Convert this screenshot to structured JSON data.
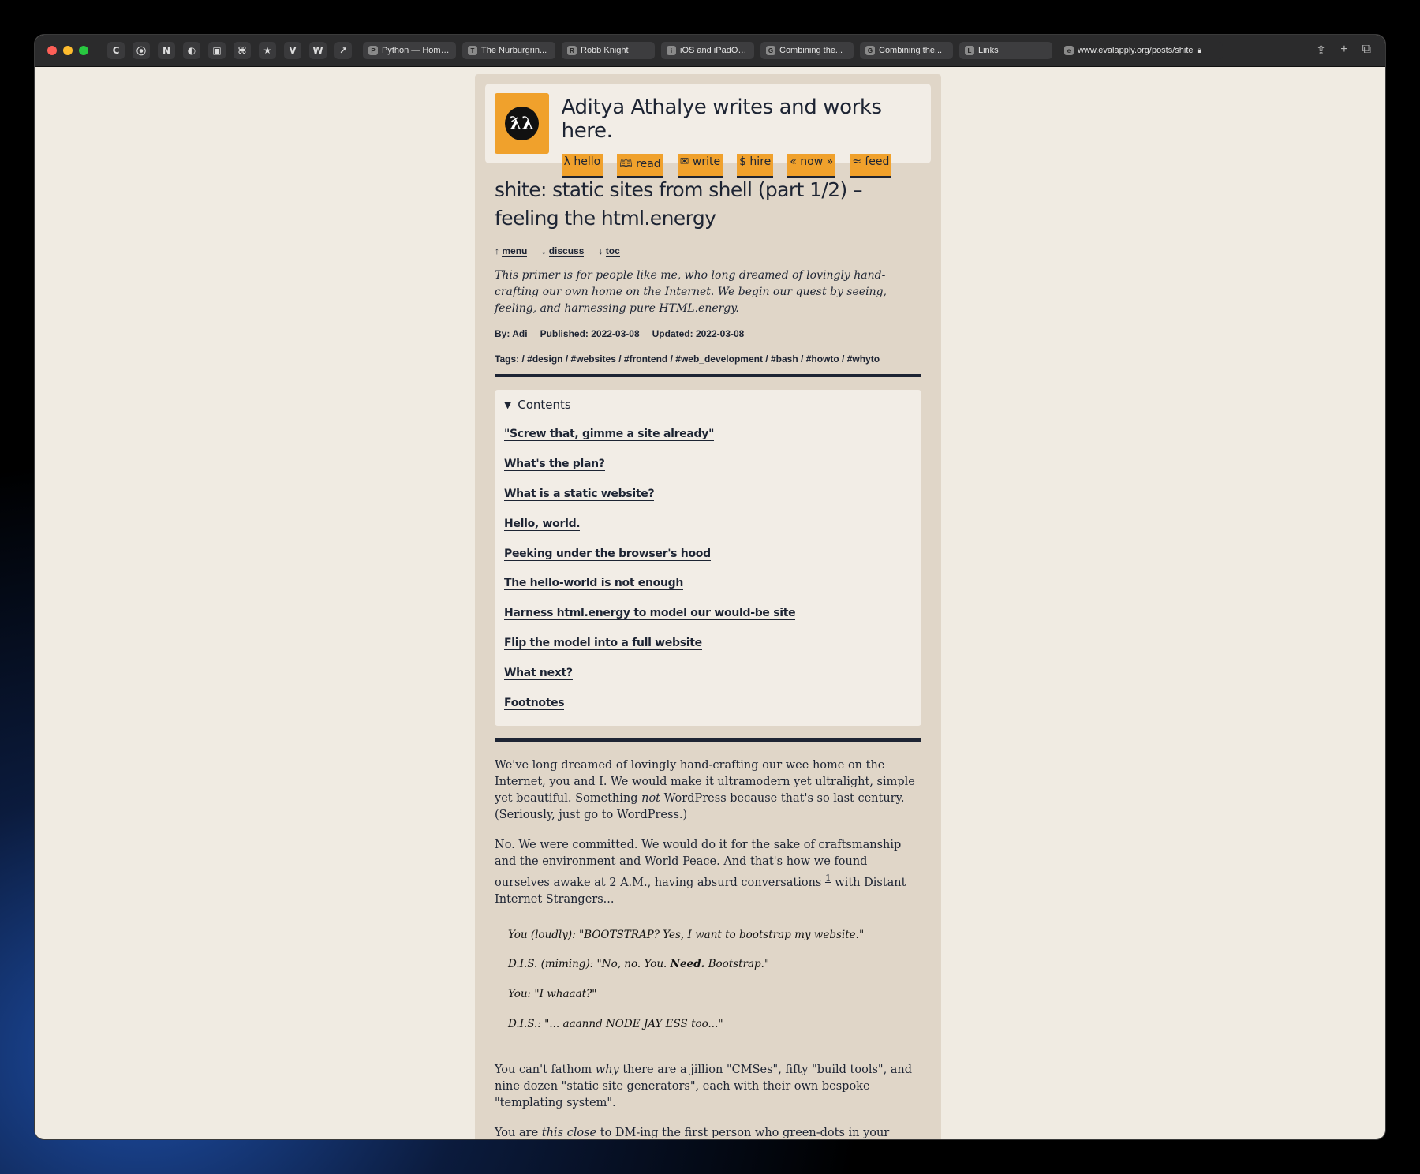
{
  "browser": {
    "favorites": [
      "C",
      "⦿",
      "N",
      "◐",
      "▣",
      "⌘",
      "★",
      "V",
      "W",
      "↗"
    ],
    "tabs": [
      {
        "label": "Python — Home...",
        "icon": "P"
      },
      {
        "label": "The Nurburgrin...",
        "icon": "T"
      },
      {
        "label": "Robb Knight",
        "icon": "R"
      },
      {
        "label": "iOS and iPadOS...",
        "icon": "i"
      },
      {
        "label": "Combining the...",
        "icon": "G"
      },
      {
        "label": "Combining the...",
        "icon": "G"
      },
      {
        "label": "Links",
        "icon": "L"
      }
    ],
    "active_tab": {
      "label": "www.evalapply.org/posts/shite",
      "icon": "e"
    },
    "right_icons": [
      "share-icon",
      "new-tab-icon",
      "tab-overview-icon"
    ]
  },
  "site": {
    "logo_text": "ƛλ",
    "title": "Aditya Athalye writes and works here.",
    "nav": [
      "λ hello",
      "🕮 read",
      "✉ write",
      "$ hire",
      "« now »",
      "≈ feed"
    ]
  },
  "post": {
    "title": "shite: static sites from shell (part 1/2) – feeling the html.energy",
    "jump": [
      {
        "arrow": "↑",
        "label": "menu"
      },
      {
        "arrow": "↓",
        "label": "discuss"
      },
      {
        "arrow": "↓",
        "label": "toc"
      }
    ],
    "summary": "This primer is for people like me, who long dreamed of lovingly hand-crafting our own home on the Internet. We begin our quest by seeing, feeling, and harnessing pure HTML.energy.",
    "by": "By: Adi",
    "published": "Published: 2022-03-08",
    "updated": "Updated: 2022-03-08",
    "tags_label": "Tags:",
    "tags": [
      "#design",
      "#websites",
      "#frontend",
      "#web_development",
      "#bash",
      "#howto",
      "#whyto"
    ],
    "toc_label": "Contents",
    "toc": [
      "\"Screw that, gimme a site already\"",
      "What's the plan?",
      "What is a static website?",
      "Hello, world.",
      "Peeking under the browser's hood",
      "The hello-world is not enough",
      "Harness html.energy to model our would-be site",
      "Flip the model into a full website",
      "What next?",
      "Footnotes"
    ],
    "para1": {
      "a": "We've long dreamed of lovingly hand-crafting our wee home on the Internet, you and I. We would make it ultramodern yet ultralight, simple yet beautiful. Something ",
      "em": "not",
      "b": " WordPress because that's so last century. (Seriously, just go to WordPress.)"
    },
    "para2": {
      "a": "No. We were committed. We would do it for the sake of craftsmanship and the environment and World Peace. And that's how we found ourselves awake at 2 A.M., having absurd conversations ",
      "fn": "1",
      "b": " with Distant Internet Strangers..."
    },
    "quote": [
      {
        "a": "You (loudly): \"BOOTSTRAP? Yes, I want to bootstrap my website.\"",
        "strong": "",
        "b": ""
      },
      {
        "a": "D.I.S. (miming): \"No, no. You. ",
        "strong": "Need.",
        "b": " Bootstrap.\""
      },
      {
        "a": "You: \"I whaaat?\"",
        "strong": "",
        "b": ""
      },
      {
        "a": "D.I.S.: \"... aaannd NODE JAY ESS too...\"",
        "strong": "",
        "b": ""
      }
    ],
    "para3": {
      "a": "You can't fathom ",
      "em": "why",
      "b": " there are a jillion \"CMSes\", fifty \"build tools\", and nine dozen \"static site generators\", each with their own bespoke \"templating system\"."
    },
    "para4": {
      "a": "You are ",
      "em": "this close",
      "b": " to DM-ing the first person who green-dots in your current Slack. \"Sheesh. Why even bother with static sites when a single-click WordPress install gets you there?\""
    }
  }
}
